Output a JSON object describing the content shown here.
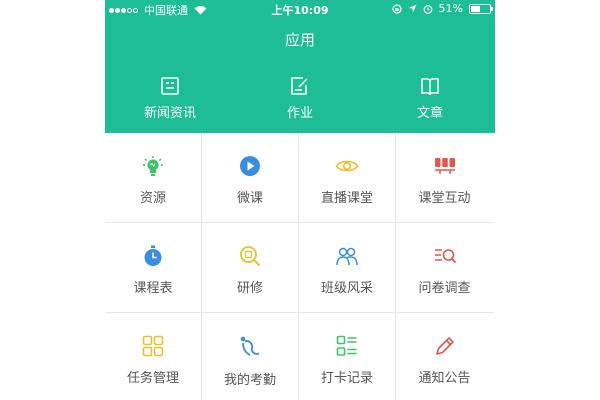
{
  "status_bar": {
    "carrier": "中国联通",
    "time": "上午10:09",
    "battery_percent": "51%",
    "battery_level": 0.51
  },
  "header": {
    "title": "应用",
    "background_color": "#1dbe96"
  },
  "top_nav": [
    {
      "label": "新闻资讯",
      "icon": "newspaper-icon"
    },
    {
      "label": "作业",
      "icon": "edit-document-icon"
    },
    {
      "label": "文章",
      "icon": "book-icon"
    }
  ],
  "apps": [
    {
      "label": "资源",
      "icon": "lightbulb-icon",
      "color": "#3cc46a"
    },
    {
      "label": "微课",
      "icon": "play-circle-icon",
      "color": "#3a8ee0"
    },
    {
      "label": "直播课堂",
      "icon": "eye-icon",
      "color": "#e9c12e"
    },
    {
      "label": "课堂互动",
      "icon": "interaction-icon",
      "color": "#e2564b"
    },
    {
      "label": "课程表",
      "icon": "stopwatch-icon",
      "color": "#3a8ee0"
    },
    {
      "label": "研修",
      "icon": "magnifier-icon",
      "color": "#e9c12e"
    },
    {
      "label": "班级风采",
      "icon": "group-icon",
      "color": "#3a8ee0"
    },
    {
      "label": "问卷调查",
      "icon": "survey-icon",
      "color": "#e2564b"
    },
    {
      "label": "任务管理",
      "icon": "tasks-grid-icon",
      "color": "#e9c12e"
    },
    {
      "label": "我的考勤",
      "icon": "attendance-icon",
      "color": "#3a8ee0"
    },
    {
      "label": "打卡记录",
      "icon": "checklist-icon",
      "color": "#3cc46a"
    },
    {
      "label": "通知公告",
      "icon": "pencil-icon",
      "color": "#e2564b"
    }
  ]
}
